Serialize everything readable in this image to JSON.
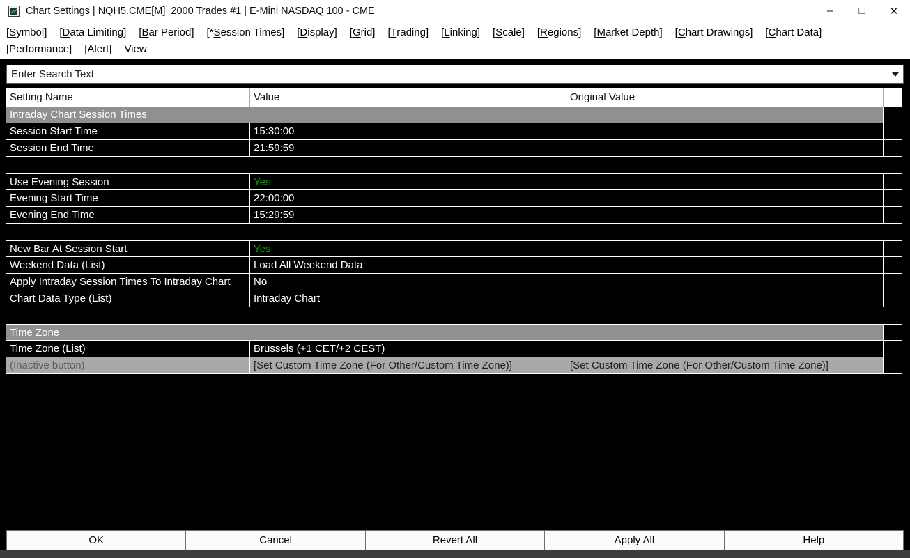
{
  "window": {
    "title": "Chart Settings | NQH5.CME[M]  2000 Trades #1 | E-Mini NASDAQ 100 - CME",
    "minimize": "–",
    "maximize": "□",
    "close": "✕"
  },
  "menubar": {
    "row1": [
      {
        "pre": "[",
        "mn": "S",
        "post": "ymbol]"
      },
      {
        "pre": "[",
        "mn": "D",
        "post": "ata Limiting]"
      },
      {
        "pre": "[",
        "mn": "B",
        "post": "ar Period]"
      },
      {
        "pre": "[*",
        "mn": "S",
        "post": "ession Times]"
      },
      {
        "pre": "[",
        "mn": "D",
        "post": "isplay]"
      },
      {
        "pre": "[",
        "mn": "G",
        "post": "rid]"
      },
      {
        "pre": "[",
        "mn": "T",
        "post": "rading]"
      },
      {
        "pre": "[",
        "mn": "L",
        "post": "inking]"
      },
      {
        "pre": "[",
        "mn": "S",
        "post": "cale]"
      },
      {
        "pre": "[",
        "mn": "R",
        "post": "egions]"
      },
      {
        "pre": "[",
        "mn": "M",
        "post": "arket Depth]"
      },
      {
        "pre": "[",
        "mn": "C",
        "post": "hart Drawings]"
      },
      {
        "pre": "[",
        "mn": "C",
        "post": "hart Data]"
      }
    ],
    "row2": [
      {
        "pre": "[",
        "mn": "P",
        "post": "erformance]"
      },
      {
        "pre": "[",
        "mn": "A",
        "post": "lert]"
      },
      {
        "pre": "",
        "mn": "V",
        "post": "iew"
      }
    ]
  },
  "search": {
    "placeholder": "Enter Search Text"
  },
  "table": {
    "headers": [
      "Setting Name",
      "Value",
      "Original Value"
    ],
    "rows": [
      {
        "type": "section",
        "name": "Intraday Chart Session Times"
      },
      {
        "type": "item",
        "name": "Session Start Time",
        "value": "15:30:00",
        "orig": ""
      },
      {
        "type": "item",
        "name": "Session End Time",
        "value": "21:59:59",
        "orig": ""
      },
      {
        "type": "spacer"
      },
      {
        "type": "item",
        "name": "Use Evening Session",
        "value": "Yes",
        "orig": ""
      },
      {
        "type": "item",
        "name": "Evening Start Time",
        "value": "22:00:00",
        "orig": ""
      },
      {
        "type": "item",
        "name": "Evening End Time",
        "value": "15:29:59",
        "orig": ""
      },
      {
        "type": "spacer"
      },
      {
        "type": "item",
        "name": "New Bar At Session Start",
        "value": "Yes",
        "orig": ""
      },
      {
        "type": "item",
        "name": "Weekend Data (List)",
        "value": "Load All Weekend Data",
        "orig": ""
      },
      {
        "type": "item",
        "name": "Apply Intraday Session Times To Intraday Chart",
        "value": "No",
        "orig": ""
      },
      {
        "type": "item",
        "name": "Chart Data Type (List)",
        "value": "Intraday Chart",
        "orig": ""
      },
      {
        "type": "spacer"
      },
      {
        "type": "section",
        "name": "Time Zone"
      },
      {
        "type": "item",
        "name": "Time Zone (List)",
        "value": "Brussels (+1 CET/+2 CEST)",
        "orig": ""
      },
      {
        "type": "inactive",
        "name": "(Inactive button)",
        "value": "[Set Custom Time Zone (For Other/Custom Time Zone)]",
        "orig": "[Set Custom Time Zone (For Other/Custom Time Zone)]"
      }
    ]
  },
  "buttons": [
    "OK",
    "Cancel",
    "Revert All",
    "Apply All",
    "Help"
  ],
  "colors": {
    "value_yes_green": "#00a400",
    "section_header_bg": "#909090",
    "inactive_row_bg": "#a9a9a9",
    "row_text": "#ffffff",
    "row_bg": "#000000"
  }
}
